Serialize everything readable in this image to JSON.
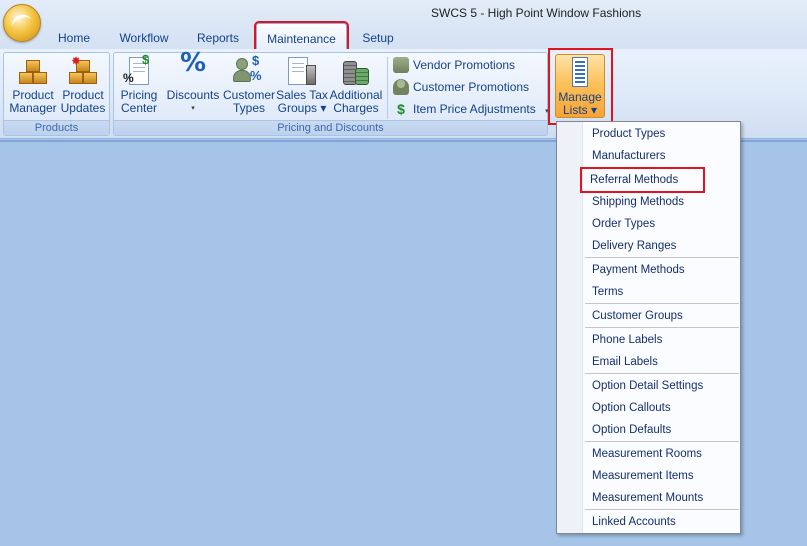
{
  "window": {
    "title": "SWCS 5 - High Point Window Fashions"
  },
  "tabs": [
    {
      "label": "Home"
    },
    {
      "label": "Workflow"
    },
    {
      "label": "Reports"
    },
    {
      "label": "Maintenance"
    },
    {
      "label": "Setup"
    }
  ],
  "active_tab": "Maintenance",
  "ribbon": {
    "products_group": {
      "caption": "Products",
      "product_manager": {
        "line1": "Product",
        "line2": "Manager"
      },
      "product_updates": {
        "line1": "Product",
        "line2": "Updates"
      }
    },
    "pricing_group": {
      "caption": "Pricing and Discounts",
      "pricing_center": {
        "line1": "Pricing",
        "line2": "Center"
      },
      "discounts": {
        "line1": "Discounts",
        "line2": "▾"
      },
      "customer_types": {
        "line1": "Customer",
        "line2": "Types"
      },
      "sales_tax_groups": {
        "line1": "Sales Tax",
        "line2": "Groups ▾"
      },
      "additional_charges": {
        "line1": "Additional",
        "line2": "Charges"
      },
      "vendor_promotions": "Vendor Promotions",
      "customer_promotions": "Customer Promotions",
      "item_price_adjustments": "Item Price Adjustments",
      "item_price_arrow": "▾"
    },
    "manage_lists": {
      "line1": "Manage",
      "line2": "Lists ▾"
    }
  },
  "menu": {
    "items": [
      "Product Types",
      "Manufacturers",
      "Referral Methods",
      "Shipping Methods",
      "Order Types",
      "Delivery Ranges",
      "Payment Methods",
      "Terms",
      "Customer Groups",
      "Phone Labels",
      "Email Labels",
      "Option Detail Settings",
      "Option Callouts",
      "Option Defaults",
      "Measurement Rooms",
      "Measurement Items",
      "Measurement Mounts",
      "Linked Accounts"
    ],
    "highlighted_item": "Referral Methods"
  },
  "colors": {
    "highlight_box": "#e0141e",
    "workspace": "#a5c4e8",
    "manage_lists_active": "#f7a338"
  }
}
